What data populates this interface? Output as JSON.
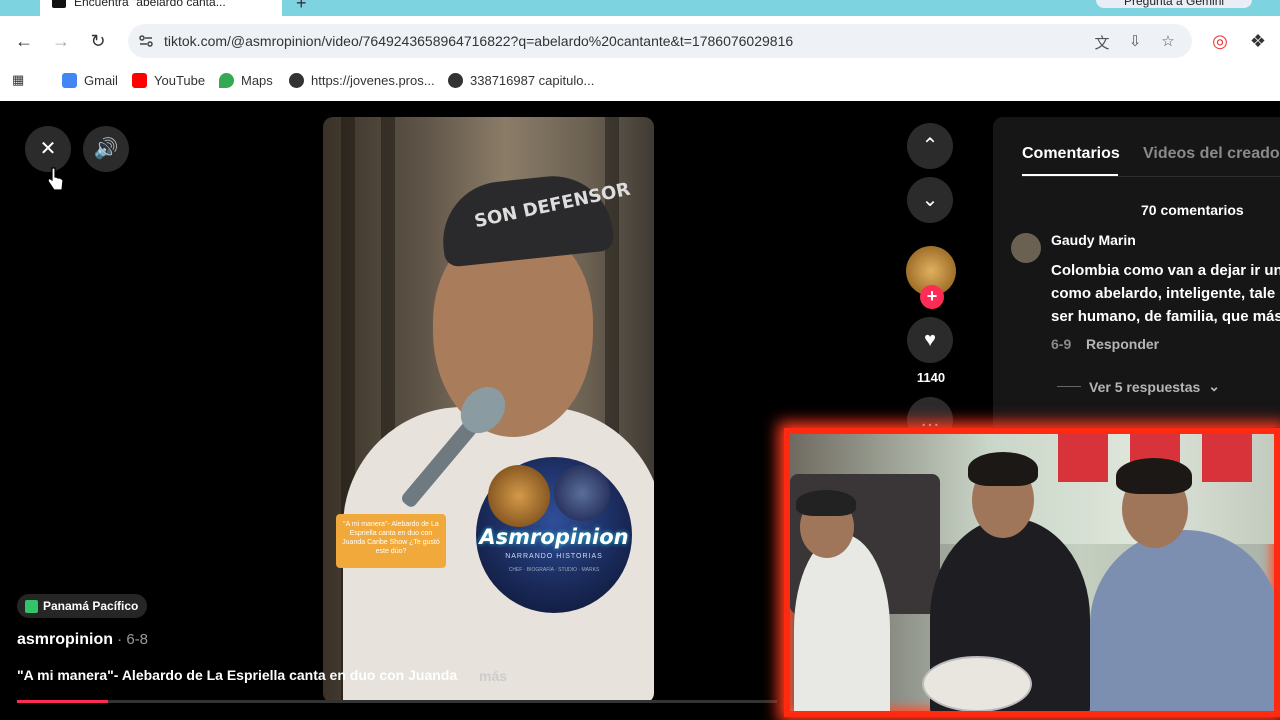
{
  "browser": {
    "tab_title": "Encuentra \"abelardo canta...",
    "gemini_label": "Pregunta a Gemini",
    "url": "tiktok.com/@asmropinion/video/7649243658964716822?q=abelardo%20cantante&t=1786076029816",
    "bookmarks": [
      {
        "label": "Gmail",
        "icon": "gmail-icon",
        "color": "#4285f4"
      },
      {
        "label": "YouTube",
        "icon": "youtube-icon",
        "color": "#ff0000"
      },
      {
        "label": "Maps",
        "icon": "maps-icon",
        "color": "#34a853"
      },
      {
        "label": "https://jovenes.pros...",
        "icon": "globe-icon",
        "color": "#333333"
      },
      {
        "label": "338716987 capitulo...",
        "icon": "globe-icon",
        "color": "#333333"
      }
    ]
  },
  "player": {
    "location": "Panamá Pacífico",
    "author": "asmropinion",
    "date": " · 6-8",
    "description": "\"A mi manera\"- Alebardo de La Espriella canta en duo con Juanda",
    "more": "más",
    "like_count": "1140",
    "progress": 0.12,
    "video_caption": "\"A mi manera\"- Alebardo de La Espriella canta en duo con Juanda Caribe Show ¿Te gustó este dúo?",
    "video_cap_text": "SON DEFENSOR",
    "logo_title": "Asmropinion",
    "logo_subtitle": "NARRANDO HISTORIAS",
    "logo_small": "CHEF · BIOGRAFÍA · STUDIO · MARKS"
  },
  "panel": {
    "tab_comments": "Comentarios",
    "tab_videos": "Videos del creador",
    "comment_count": "70 comentarios",
    "comment": {
      "name": "Gaudy Marin",
      "lines": [
        "Colombia como van a dejar ir un",
        "como abelardo, inteligente, tale",
        "ser humano, de familia, que más"
      ],
      "date": "6-9",
      "reply": "Responder",
      "replies": "Ver 5 respuestas"
    }
  },
  "colors": {
    "accent": "#fe2c55",
    "overlay_border": "#ff2a10",
    "tabstrip": "#7dd3e0"
  }
}
